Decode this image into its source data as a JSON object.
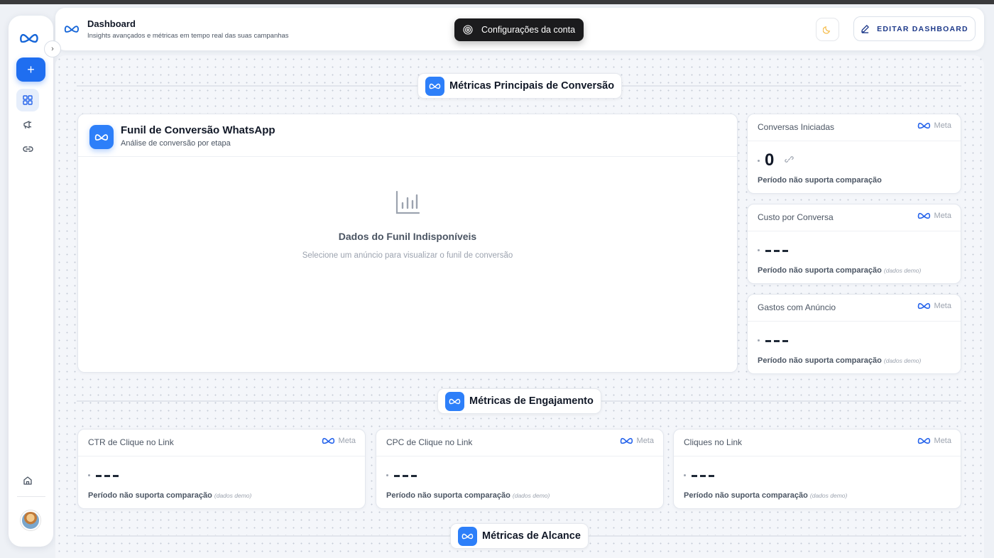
{
  "header": {
    "title": "Dashboard",
    "subtitle": "Insights avançados e métricas em tempo real das suas campanhas",
    "edit_button": "EDITAR DASHBOARD"
  },
  "toast": {
    "text": "Configurações da conta"
  },
  "sidebar": {
    "items": [
      {
        "icon": "dashboard-grid-icon",
        "active": true
      },
      {
        "icon": "megaphone-icon",
        "active": false
      },
      {
        "icon": "link-icon",
        "active": false
      },
      {
        "icon": "home-icon",
        "active": false
      }
    ]
  },
  "sections": {
    "conversion": "Métricas Principais de Conversão",
    "engagement": "Métricas de Engajamento",
    "reach": "Métricas de Alcance"
  },
  "funnel": {
    "title": "Funil de Conversão WhatsApp",
    "subtitle": "Análise de conversão por etapa",
    "empty_title": "Dados do Funil Indisponíveis",
    "empty_subtitle": "Selecione um anúncio para visualizar o funil de conversão"
  },
  "metrics": {
    "source_label": "Meta",
    "comparison_text": "Período não suporta comparação",
    "demo_text": "(dados demo)",
    "conversas": {
      "title": "Conversas Iniciadas",
      "value": "0"
    },
    "custo": {
      "title": "Custo por Conversa"
    },
    "gastos": {
      "title": "Gastos com Anúncio"
    },
    "ctr": {
      "title": "CTR de Clique no Link"
    },
    "cpc": {
      "title": "CPC de Clique no Link"
    },
    "cliques": {
      "title": "Cliques no Link"
    }
  },
  "colors": {
    "accent": "#1f6ef0",
    "meta_blue": "#2d7ff9",
    "toast_bg": "#1b1b1d"
  }
}
